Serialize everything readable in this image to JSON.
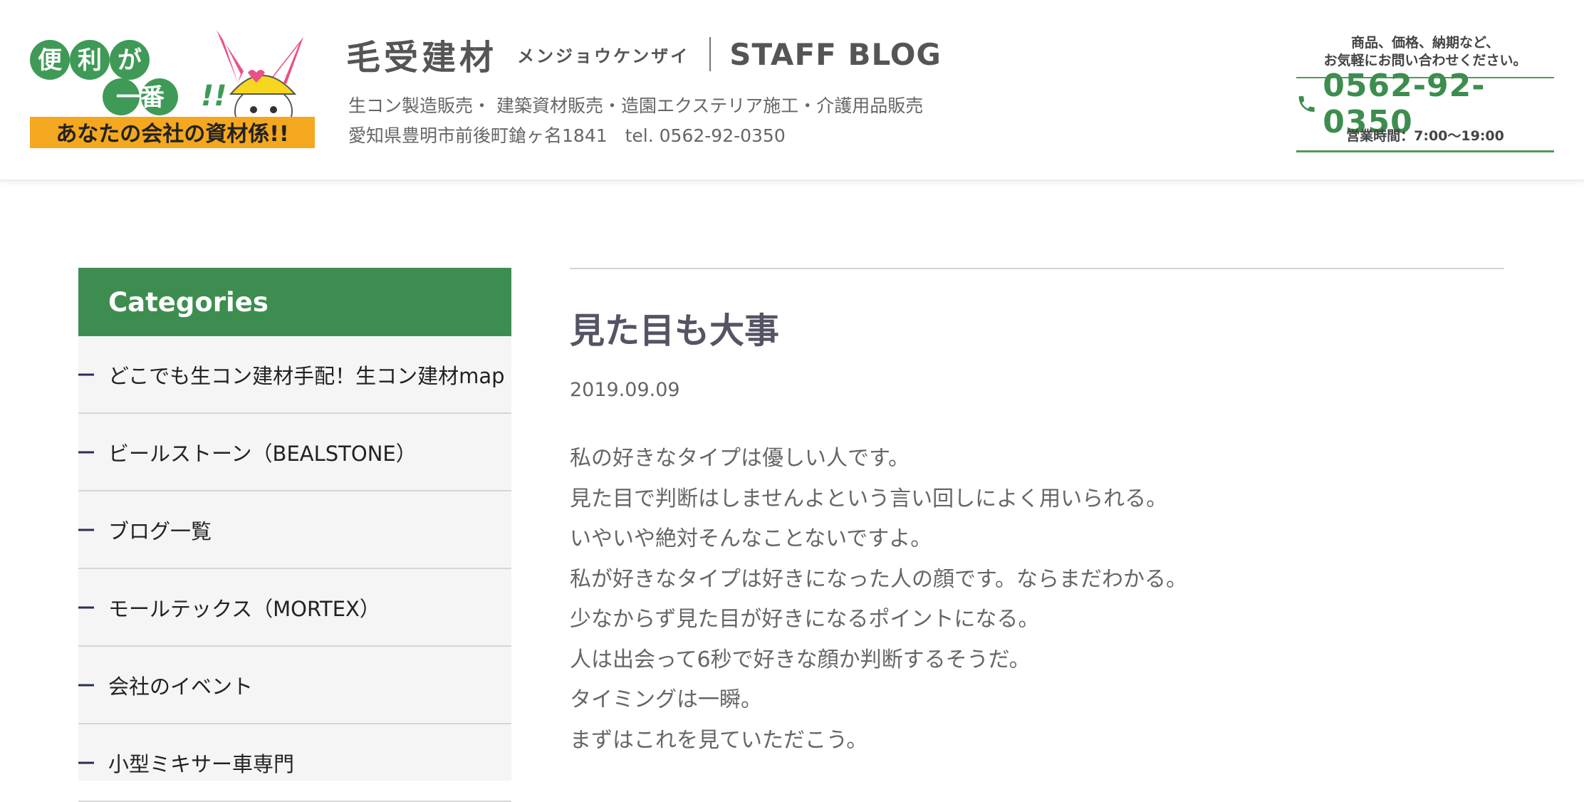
{
  "header": {
    "logo": {
      "line1": "便利が",
      "line2": "一番!!",
      "line3": "あなたの会社の資材係!!"
    },
    "brand_name": "毛受建材",
    "brand_kana": "メンジョウケンザイ",
    "brand_blog": "STAFF BLOG",
    "tagline": "生コン製造販売・ 建築資材販売・造園エクステリア施工・介護用品販売",
    "address": "愛知県豊明市前後町鎗ヶ名1841　tel. 0562-92-0350",
    "contact": {
      "note_line1": "商品、価格、納期など、",
      "note_line2": "お気軽にお問い合わせください。",
      "phone": "0562-92-0350",
      "hours": "営業時間：7:00〜19:00",
      "phone_icon": "phone-icon"
    }
  },
  "sidebar": {
    "title": "Categories",
    "items": [
      {
        "label": "どこでも生コン建材手配！生コン建材map"
      },
      {
        "label": "ビールストーン（BEALSTONE）"
      },
      {
        "label": "ブログ一覧"
      },
      {
        "label": "モールテックス（MORTEX）"
      },
      {
        "label": "会社のイベント"
      },
      {
        "label": "小型ミキサー車専門"
      }
    ]
  },
  "post": {
    "title": "見た目も大事",
    "date": "2019.09.09",
    "paragraphs": [
      "私の好きなタイプは優しい人です。",
      "見た目で判断はしませんよという言い回しによく用いられる。",
      "いやいや絶対そんなことないですよ。",
      "私が好きなタイプは好きになった人の顔です。ならまだわかる。",
      "少なからず見た目が好きになるポイントになる。",
      "人は出会って6秒で好きな顔か判断するそうだ。",
      "タイミングは一瞬。",
      "まずはこれを見ていただこう。"
    ]
  },
  "colors": {
    "accent_green": "#3e8d50",
    "phone_green": "#3d8d4e",
    "logo_orange": "#f3a81f",
    "logo_green": "#3f9a57"
  }
}
